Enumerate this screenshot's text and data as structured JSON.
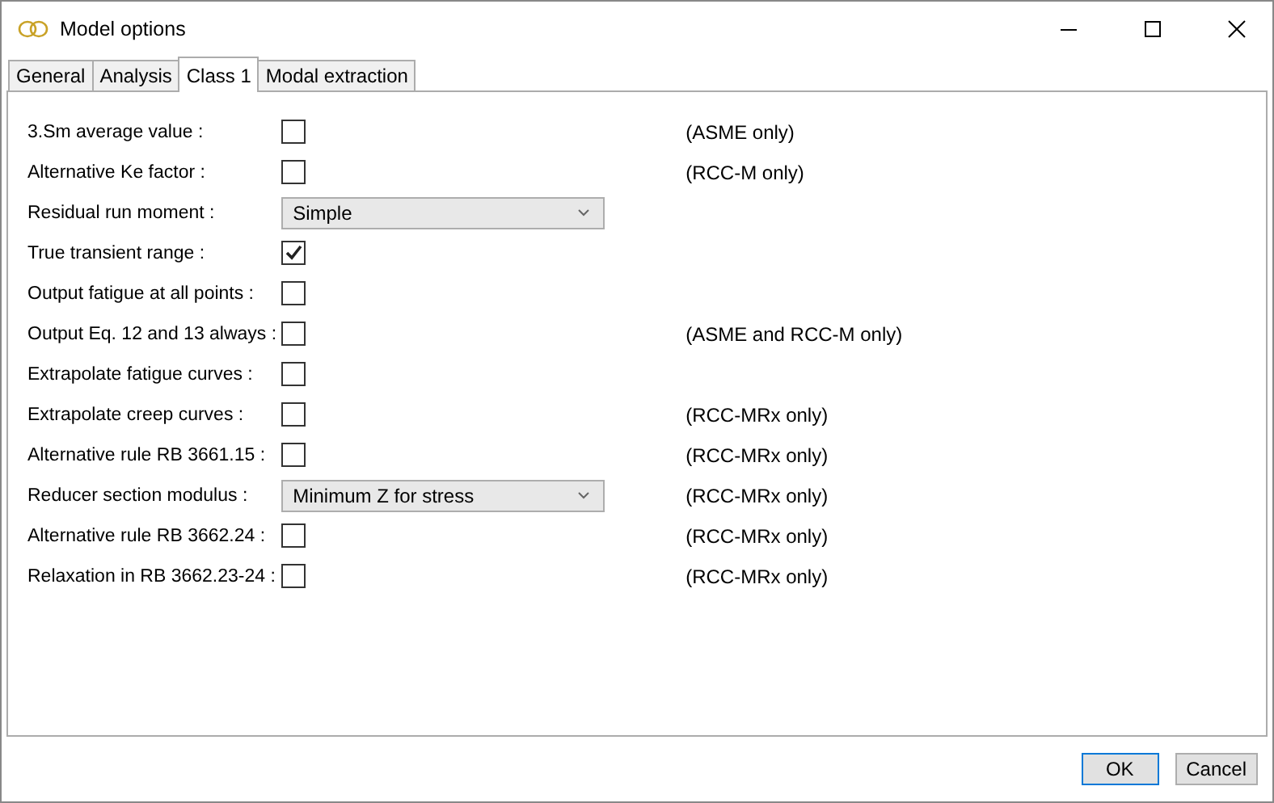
{
  "window": {
    "title": "Model options"
  },
  "tabs": [
    {
      "label": "General",
      "selected": false
    },
    {
      "label": "Analysis",
      "selected": false
    },
    {
      "label": "Class 1",
      "selected": true
    },
    {
      "label": "Modal extraction",
      "selected": false
    }
  ],
  "rows": [
    {
      "kind": "checkbox",
      "label": "3.Sm average value :",
      "checked": false,
      "note": "(ASME only)"
    },
    {
      "kind": "checkbox",
      "label": "Alternative Ke factor :",
      "checked": false,
      "note": "(RCC-M only)"
    },
    {
      "kind": "dropdown",
      "label": "Residual run moment :",
      "value": "Simple"
    },
    {
      "kind": "checkbox",
      "label": "True transient range :",
      "checked": true
    },
    {
      "kind": "checkbox",
      "label": "Output fatigue at all points :",
      "checked": false
    },
    {
      "kind": "checkbox",
      "label": "Output Eq. 12 and 13 always :",
      "checked": false,
      "note": "(ASME and RCC-M only)"
    },
    {
      "kind": "checkbox",
      "label": "Extrapolate fatigue curves :",
      "checked": false
    },
    {
      "kind": "checkbox",
      "label": "Extrapolate creep curves :",
      "checked": false,
      "note": "(RCC-MRx only)"
    },
    {
      "kind": "checkbox",
      "label": "Alternative rule RB 3661.15 :",
      "checked": false,
      "note": "(RCC-MRx only)"
    },
    {
      "kind": "dropdown",
      "label": "Reducer section modulus :",
      "value": "Minimum Z for stress",
      "note": "(RCC-MRx only)"
    },
    {
      "kind": "checkbox",
      "label": "Alternative rule RB 3662.24 :",
      "checked": false,
      "note": "(RCC-MRx only)"
    },
    {
      "kind": "checkbox",
      "label": "Relaxation in RB 3662.23-24 :",
      "checked": false,
      "note": "(RCC-MRx only)"
    }
  ],
  "buttons": [
    {
      "label": "OK",
      "default": true
    },
    {
      "label": "Cancel",
      "default": false
    }
  ]
}
